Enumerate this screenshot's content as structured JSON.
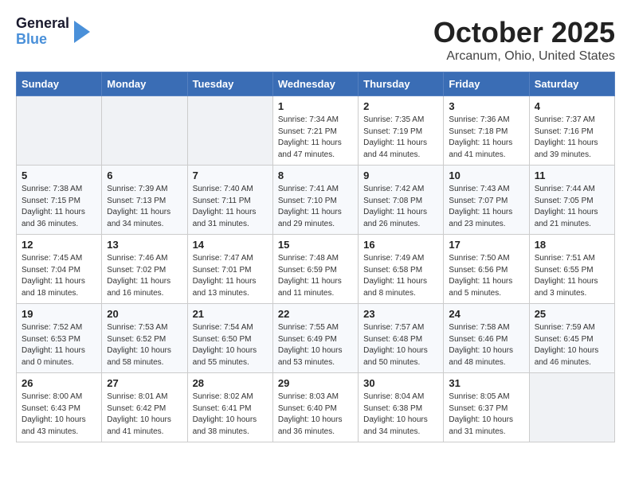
{
  "logo": {
    "line1": "General",
    "line2": "Blue"
  },
  "title": "October 2025",
  "location": "Arcanum, Ohio, United States",
  "weekdays": [
    "Sunday",
    "Monday",
    "Tuesday",
    "Wednesday",
    "Thursday",
    "Friday",
    "Saturday"
  ],
  "weeks": [
    [
      {
        "day": "",
        "info": ""
      },
      {
        "day": "",
        "info": ""
      },
      {
        "day": "",
        "info": ""
      },
      {
        "day": "1",
        "info": "Sunrise: 7:34 AM\nSunset: 7:21 PM\nDaylight: 11 hours and 47 minutes."
      },
      {
        "day": "2",
        "info": "Sunrise: 7:35 AM\nSunset: 7:19 PM\nDaylight: 11 hours and 44 minutes."
      },
      {
        "day": "3",
        "info": "Sunrise: 7:36 AM\nSunset: 7:18 PM\nDaylight: 11 hours and 41 minutes."
      },
      {
        "day": "4",
        "info": "Sunrise: 7:37 AM\nSunset: 7:16 PM\nDaylight: 11 hours and 39 minutes."
      }
    ],
    [
      {
        "day": "5",
        "info": "Sunrise: 7:38 AM\nSunset: 7:15 PM\nDaylight: 11 hours and 36 minutes."
      },
      {
        "day": "6",
        "info": "Sunrise: 7:39 AM\nSunset: 7:13 PM\nDaylight: 11 hours and 34 minutes."
      },
      {
        "day": "7",
        "info": "Sunrise: 7:40 AM\nSunset: 7:11 PM\nDaylight: 11 hours and 31 minutes."
      },
      {
        "day": "8",
        "info": "Sunrise: 7:41 AM\nSunset: 7:10 PM\nDaylight: 11 hours and 29 minutes."
      },
      {
        "day": "9",
        "info": "Sunrise: 7:42 AM\nSunset: 7:08 PM\nDaylight: 11 hours and 26 minutes."
      },
      {
        "day": "10",
        "info": "Sunrise: 7:43 AM\nSunset: 7:07 PM\nDaylight: 11 hours and 23 minutes."
      },
      {
        "day": "11",
        "info": "Sunrise: 7:44 AM\nSunset: 7:05 PM\nDaylight: 11 hours and 21 minutes."
      }
    ],
    [
      {
        "day": "12",
        "info": "Sunrise: 7:45 AM\nSunset: 7:04 PM\nDaylight: 11 hours and 18 minutes."
      },
      {
        "day": "13",
        "info": "Sunrise: 7:46 AM\nSunset: 7:02 PM\nDaylight: 11 hours and 16 minutes."
      },
      {
        "day": "14",
        "info": "Sunrise: 7:47 AM\nSunset: 7:01 PM\nDaylight: 11 hours and 13 minutes."
      },
      {
        "day": "15",
        "info": "Sunrise: 7:48 AM\nSunset: 6:59 PM\nDaylight: 11 hours and 11 minutes."
      },
      {
        "day": "16",
        "info": "Sunrise: 7:49 AM\nSunset: 6:58 PM\nDaylight: 11 hours and 8 minutes."
      },
      {
        "day": "17",
        "info": "Sunrise: 7:50 AM\nSunset: 6:56 PM\nDaylight: 11 hours and 5 minutes."
      },
      {
        "day": "18",
        "info": "Sunrise: 7:51 AM\nSunset: 6:55 PM\nDaylight: 11 hours and 3 minutes."
      }
    ],
    [
      {
        "day": "19",
        "info": "Sunrise: 7:52 AM\nSunset: 6:53 PM\nDaylight: 11 hours and 0 minutes."
      },
      {
        "day": "20",
        "info": "Sunrise: 7:53 AM\nSunset: 6:52 PM\nDaylight: 10 hours and 58 minutes."
      },
      {
        "day": "21",
        "info": "Sunrise: 7:54 AM\nSunset: 6:50 PM\nDaylight: 10 hours and 55 minutes."
      },
      {
        "day": "22",
        "info": "Sunrise: 7:55 AM\nSunset: 6:49 PM\nDaylight: 10 hours and 53 minutes."
      },
      {
        "day": "23",
        "info": "Sunrise: 7:57 AM\nSunset: 6:48 PM\nDaylight: 10 hours and 50 minutes."
      },
      {
        "day": "24",
        "info": "Sunrise: 7:58 AM\nSunset: 6:46 PM\nDaylight: 10 hours and 48 minutes."
      },
      {
        "day": "25",
        "info": "Sunrise: 7:59 AM\nSunset: 6:45 PM\nDaylight: 10 hours and 46 minutes."
      }
    ],
    [
      {
        "day": "26",
        "info": "Sunrise: 8:00 AM\nSunset: 6:43 PM\nDaylight: 10 hours and 43 minutes."
      },
      {
        "day": "27",
        "info": "Sunrise: 8:01 AM\nSunset: 6:42 PM\nDaylight: 10 hours and 41 minutes."
      },
      {
        "day": "28",
        "info": "Sunrise: 8:02 AM\nSunset: 6:41 PM\nDaylight: 10 hours and 38 minutes."
      },
      {
        "day": "29",
        "info": "Sunrise: 8:03 AM\nSunset: 6:40 PM\nDaylight: 10 hours and 36 minutes."
      },
      {
        "day": "30",
        "info": "Sunrise: 8:04 AM\nSunset: 6:38 PM\nDaylight: 10 hours and 34 minutes."
      },
      {
        "day": "31",
        "info": "Sunrise: 8:05 AM\nSunset: 6:37 PM\nDaylight: 10 hours and 31 minutes."
      },
      {
        "day": "",
        "info": ""
      }
    ]
  ]
}
